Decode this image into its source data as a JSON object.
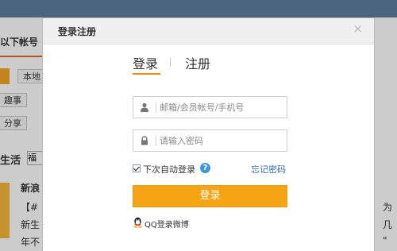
{
  "background": {
    "title": "以下帐号",
    "tags": [
      "本地",
      "趣事",
      "分享"
    ],
    "section": "生活",
    "select_value": "福",
    "headline": "新浪",
    "snippet_line1": "【#",
    "snippet_line2": "新生",
    "snippet_line3": "年不",
    "right_line1": "为",
    "right_line2": "几",
    "right_line3": "\""
  },
  "dialog": {
    "title": "登录注册",
    "close_symbol": "×",
    "tab_login": "登录",
    "tab_register": "注册",
    "account_placeholder": "邮箱/会员帐号/手机号",
    "password_placeholder": "请输入密码",
    "remember_label": "下次自动登录",
    "help_symbol": "?",
    "forgot_label": "忘记密码",
    "login_button": "登录",
    "qq_label": "QQ登录微博"
  },
  "colors": {
    "accent": "#f5a513",
    "link": "#2f6ea8",
    "help": "#3b95db"
  },
  "icons": [
    "user-icon",
    "lock-icon",
    "help-icon",
    "qq-icon",
    "close-icon"
  ]
}
